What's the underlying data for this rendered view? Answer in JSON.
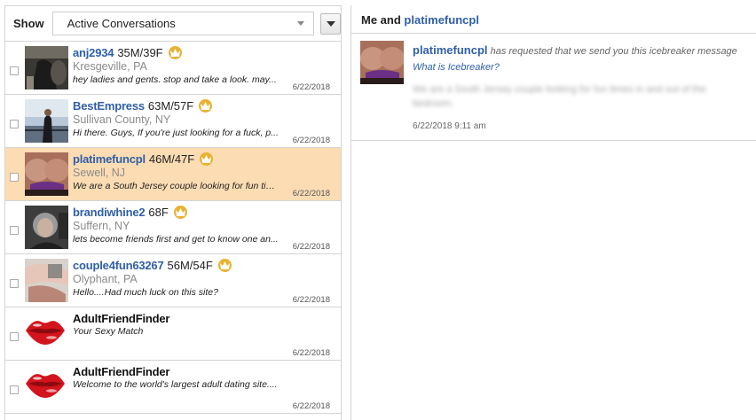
{
  "filter": {
    "label": "Show",
    "selected": "Active Conversations"
  },
  "conversations": [
    {
      "username": "anj2934",
      "ages": "35M/39F",
      "location": "Kresgeville, PA",
      "snippet": "hey ladies and gents. stop and take a look. may...",
      "date": "6/22/2018"
    },
    {
      "username": "BestEmpress",
      "ages": "63M/57F",
      "location": "Sullivan County, NY",
      "snippet": "Hi there. Guys, If you're just looking for a fuck, p...",
      "date": "6/22/2018"
    },
    {
      "username": "platimefuncpl",
      "ages": "46M/47F",
      "location": "Sewell, NJ",
      "snippet": "We are a South Jersey couple looking for fun tim...",
      "date": "6/22/2018"
    },
    {
      "username": "brandiwhine2",
      "ages": "68F",
      "location": "Suffern, NY",
      "snippet": "lets become friends first and get to know one an...",
      "date": "6/22/2018"
    },
    {
      "username": "couple4fun63267",
      "ages": "56M/54F",
      "location": "Olyphant, PA",
      "snippet": "Hello....Had much luck on this site?",
      "date": "6/22/2018"
    },
    {
      "username": "AdultFriendFinder",
      "snippet": "Your Sexy Match",
      "date": "6/22/2018"
    },
    {
      "username": "AdultFriendFinder",
      "snippet": "Welcome to the world's largest adult dating site....",
      "date": "6/22/2018"
    }
  ],
  "thread": {
    "header_prefix": "Me and",
    "header_name": "platimefuncpl",
    "message": {
      "sender": "platimefuncpl",
      "text": "has requested that we send you this icebreaker message",
      "link": "What is Icebreaker?",
      "body_blurred": "We are a South Jersey couple looking for fun times in and out of the bedroom.",
      "time": "6/22/2018 9:11 am"
    }
  },
  "colors": {
    "link_blue": "#2f5fa8",
    "selected_row": "#fcdcb3",
    "crown_gold": "#e8b232",
    "lips_red": "#d4141c"
  },
  "icons": [
    "crown-icon",
    "lips-icon",
    "dropdown-caret-icon",
    "menu-caret-icon"
  ]
}
